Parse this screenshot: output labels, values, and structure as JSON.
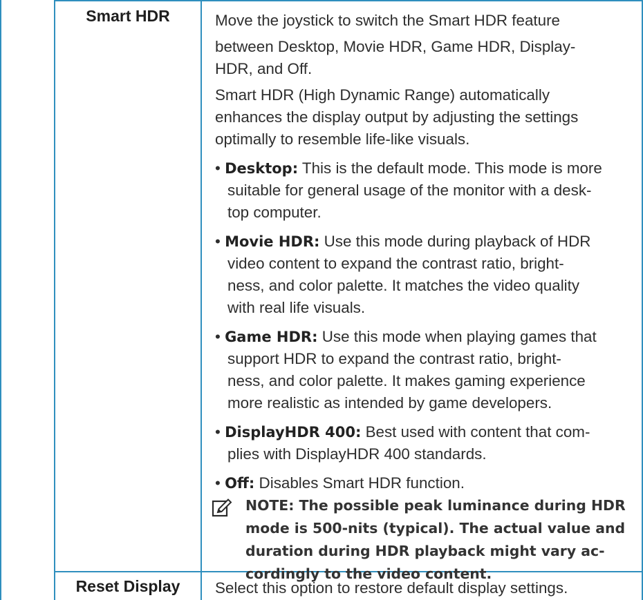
{
  "rows": [
    {
      "label": "Smart HDR",
      "intro": "Move the joystick to switch the Smart HDR feature between Desktop, Movie HDR, Game HDR, Display-HDR, and Off.",
      "intro_line1": "Move the joystick to switch the Smart HDR feature",
      "intro_line2": "between Desktop, Movie HDR, Game HDR, Display-",
      "intro_line3": "HDR, and Off.",
      "desc_line1": "Smart HDR (High Dynamic Range) automatically",
      "desc_line2": "enhances the display output by adjusting the settings",
      "desc_line3": "optimally to resemble life-like visuals.",
      "bullets": [
        {
          "term": "Desktop:",
          "line1": " This is the default mode. This mode is more",
          "line2": "suitable for general usage of the monitor with a desk-",
          "line3": "top computer."
        },
        {
          "term": "Movie HDR:",
          "line1": " Use this mode during playback of HDR",
          "line2": "video content to expand the contrast ratio, bright-",
          "line3": "ness, and color palette. It matches the video quality",
          "line4": "with real life visuals."
        },
        {
          "term": "Game HDR:",
          "line1": " Use this mode when playing games that",
          "line2": "support HDR to expand the contrast ratio, bright-",
          "line3": "ness, and color palette. It makes gaming experience",
          "line4": "more realistic as intended by game developers."
        },
        {
          "term": "DisplayHDR 400:",
          "line1": " Best used with content that com-",
          "line2": "plies with DisplayHDR 400 standards."
        },
        {
          "term": "Off:",
          "line1": " Disables Smart HDR function."
        }
      ],
      "note": {
        "icon": "note-pencil-icon",
        "line1": "NOTE: The possible peak luminance during HDR",
        "line2": "mode is 500-nits (typical). The actual value and",
        "line3": "duration during HDR playback might vary ac-",
        "line4": "cordingly to the video content."
      }
    },
    {
      "label": "Reset Display",
      "text": "Select this option to restore default display settings."
    }
  ],
  "colors": {
    "rule": "#2f8fbe",
    "text": "#2e2e2e"
  }
}
